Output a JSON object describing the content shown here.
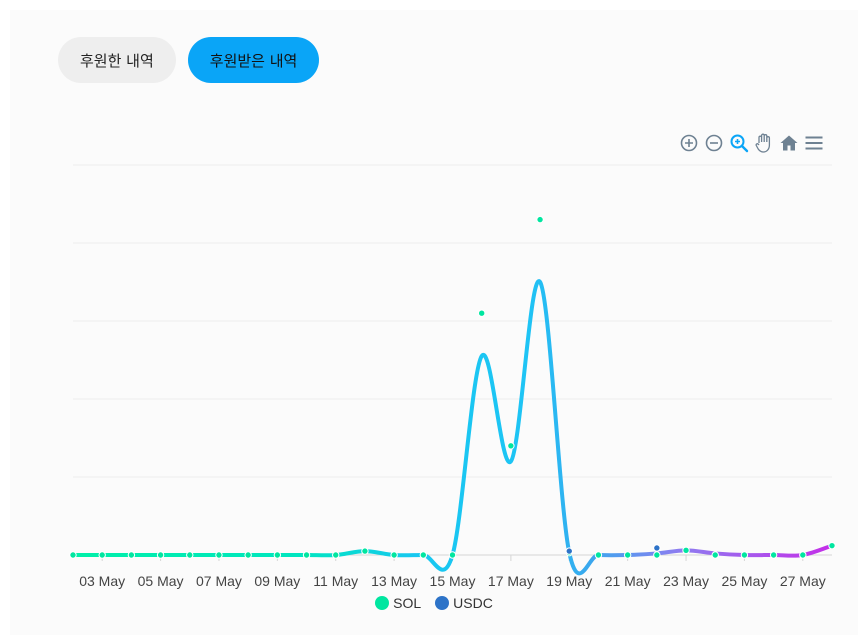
{
  "tabs": [
    {
      "label": "후원한 내역",
      "active": false
    },
    {
      "label": "후원받은 내역",
      "active": true
    }
  ],
  "toolbar": [
    "zoom-in-icon",
    "zoom-out-icon",
    "selection-zoom-icon",
    "pan-icon",
    "home-icon",
    "menu-icon"
  ],
  "colors": {
    "sol": "#00e6a0",
    "usdc": "#2d73c8",
    "accent": "#0aa5f7"
  },
  "chart_data": {
    "type": "line",
    "title": "",
    "xlabel": "",
    "ylabel": "",
    "x_tick_labels": [
      "03 May",
      "05 May",
      "07 May",
      "09 May",
      "11 May",
      "13 May",
      "15 May",
      "17 May",
      "19 May",
      "21 May",
      "23 May",
      "25 May",
      "27 May"
    ],
    "x_tick_days": [
      3,
      5,
      7,
      9,
      11,
      13,
      15,
      17,
      19,
      21,
      23,
      25,
      27
    ],
    "x_range_days": [
      2,
      28
    ],
    "ylim": [
      0,
      5
    ],
    "y_tick_labels_shown": false,
    "grid": true,
    "legend_position": "bottom",
    "series": [
      {
        "name": "SOL",
        "x_days": [
          2,
          3,
          4,
          5,
          6,
          7,
          8,
          9,
          10,
          11,
          12,
          13,
          14,
          15,
          16,
          17,
          18,
          19,
          20,
          21,
          22,
          23,
          24,
          25,
          26,
          27,
          28
        ],
        "values": [
          0,
          0,
          0,
          0,
          0,
          0,
          0,
          0,
          0,
          0,
          0.05,
          0,
          0,
          0,
          3.1,
          1.4,
          4.3,
          0.03,
          0,
          0,
          0,
          0.06,
          0,
          0,
          0,
          0,
          0.12
        ],
        "curve": [
          0,
          0,
          0,
          0,
          0,
          0,
          0,
          0,
          0,
          0,
          0.05,
          0,
          0,
          0,
          2.55,
          1.2,
          3.5,
          0.03,
          0,
          0,
          0.02,
          0.06,
          0.02,
          0,
          0,
          0,
          0.12
        ]
      },
      {
        "name": "USDC",
        "x_days": [
          19,
          22
        ],
        "values": [
          0.05,
          0.09
        ]
      }
    ]
  }
}
